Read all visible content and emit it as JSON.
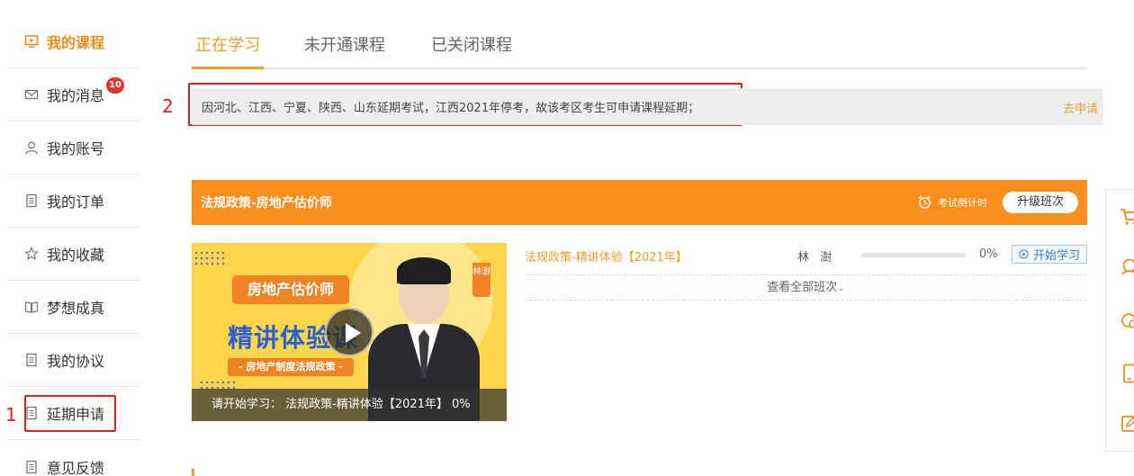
{
  "sidebar": {
    "items": [
      {
        "label": "我的课程",
        "icon": "play-screen-icon"
      },
      {
        "label": "我的消息",
        "icon": "mail-icon",
        "badge": "10"
      },
      {
        "label": "我的账号",
        "icon": "user-icon"
      },
      {
        "label": "我的订单",
        "icon": "document-icon"
      },
      {
        "label": "我的收藏",
        "icon": "star-icon"
      },
      {
        "label": "梦想成真",
        "icon": "book-icon"
      },
      {
        "label": "我的协议",
        "icon": "document-icon"
      },
      {
        "label": "延期申请",
        "icon": "document-icon"
      },
      {
        "label": "意见反馈",
        "icon": "document-icon"
      }
    ]
  },
  "annotations": {
    "one": "1",
    "two": "2"
  },
  "tabs": [
    "正在学习",
    "未开通课程",
    "已关闭课程"
  ],
  "notice": {
    "text": "因河北、江西、宁夏、陕西、山东延期考试，江西2021年停考，故该考区考生可申请课程延期；",
    "link": "去申请"
  },
  "course": {
    "title": "法规政策-房地产估价师",
    "countdown_label": "考试倒计时",
    "upgrade_label": "升级班次",
    "thumbnail": {
      "pill": "房地产估价师",
      "headline": "精讲体验课",
      "subtitle": "- 房地产制度法规政策 -",
      "teacher_tag": "林澍",
      "caption": "请开始学习： 法规政策-精讲体验【2021年】 0%"
    },
    "lesson": {
      "name": "法规政策-精讲体验【2021年】",
      "teacher": "林 澍",
      "progress": 0,
      "percent_label": "0%",
      "start_label": "开始学习"
    },
    "view_all": "查看全部班次"
  },
  "colors": {
    "accent": "#f39c2f",
    "course_bar": "#fb8f1d",
    "annotation": "#e02020",
    "badge": "#e8312f"
  },
  "right_toolbar": [
    "cart-icon",
    "service-icon",
    "chat-icon",
    "tablet-icon",
    "edit-icon"
  ]
}
